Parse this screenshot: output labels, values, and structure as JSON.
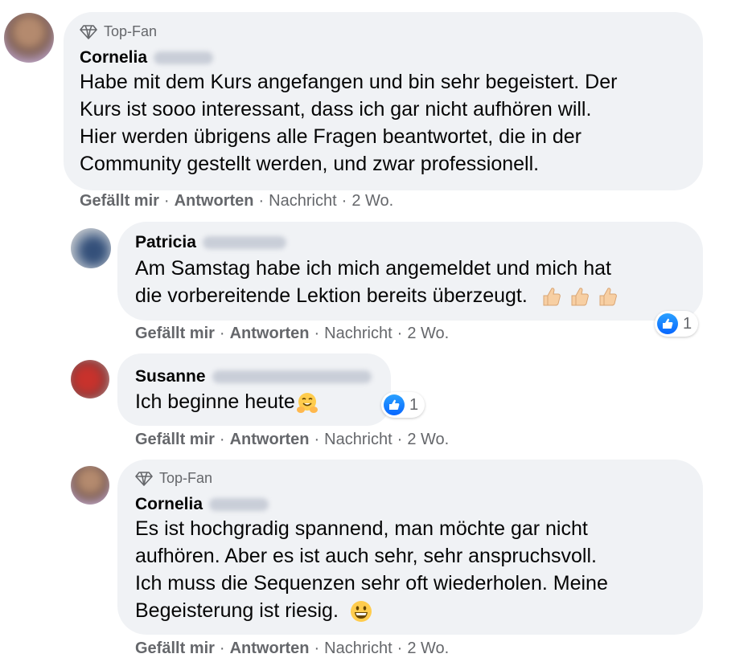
{
  "common": {
    "badge_label": "Top-Fan",
    "like_label": "Gefällt mir",
    "reply_label": "Antworten",
    "message_label": "Nachricht",
    "time_label": "2 Wo.",
    "separator": "·"
  },
  "comments": [
    {
      "author": "Cornelia",
      "has_badge": true,
      "lines": [
        "Habe mit dem Kurs angefangen und bin sehr begeistert. Der",
        "Kurs ist sooo interessant, dass ich gar nicht aufhören will.",
        "Hier werden übrigens alle Fragen beantwortet, die in der",
        "Community gestellt werden, und zwar professionell."
      ]
    },
    {
      "author": "Patricia",
      "has_badge": false,
      "lines": [
        "Am Samstag habe ich mich angemeldet und mich hat",
        "die vorbereitende Lektion bereits überzeugt."
      ],
      "reaction_count": "1",
      "trailing_emoji": "thumbs-up-light-skin x3"
    },
    {
      "author": "Susanne",
      "has_badge": false,
      "lines": [
        "Ich beginne heute"
      ],
      "reaction_count": "1",
      "trailing_emoji": "hugging-face"
    },
    {
      "author": "Cornelia",
      "has_badge": true,
      "lines": [
        "Es ist hochgradig spannend, man möchte gar nicht",
        "aufhören. Aber es ist auch sehr, sehr anspruchsvoll.",
        "Ich muss die Sequenzen sehr oft wiederholen. Meine",
        "Begeisterung ist riesig."
      ],
      "trailing_emoji": "grinning-face"
    }
  ],
  "colors": {
    "bubble": "#f0f2f5",
    "meta_text": "#65676b",
    "text": "#050505",
    "like_blue": "#0866ff"
  }
}
